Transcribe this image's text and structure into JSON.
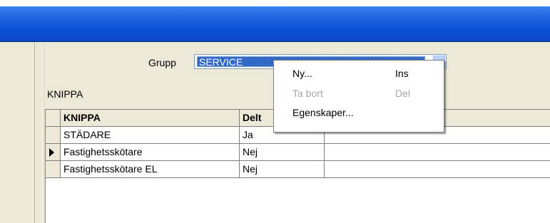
{
  "group": {
    "label": "Grupp",
    "value": "SERVICE"
  },
  "caption": "KNIPPA",
  "grid": {
    "columns": [
      "KNIPPA",
      "Delt"
    ],
    "rows": [
      {
        "knippa": "STÄDARE",
        "delt": "Ja",
        "current": false
      },
      {
        "knippa": "Fastighetsskötare",
        "delt": "Nej",
        "current": true
      },
      {
        "knippa": "Fastighetsskötare EL",
        "delt": "Nej",
        "current": false
      }
    ]
  },
  "context_menu": {
    "items": [
      {
        "label": "Ny...",
        "shortcut": "Ins",
        "enabled": true
      },
      {
        "label": "Ta bort",
        "shortcut": "Del",
        "enabled": false
      },
      {
        "label": "Egenskaper...",
        "shortcut": "",
        "enabled": true
      }
    ]
  },
  "colors": {
    "title_bar": "#0a4fd6",
    "selection": "#316ac5",
    "disabled_text": "#a6a6a6"
  }
}
